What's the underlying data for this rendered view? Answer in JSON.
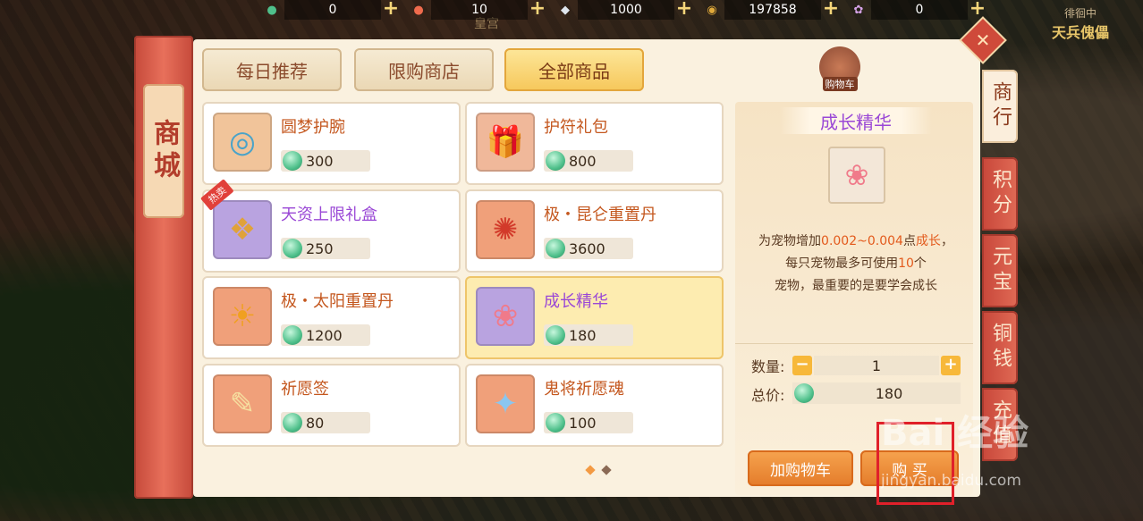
{
  "resources": [
    {
      "icon": "jade-token-icon",
      "glyph": "●",
      "color": "#4fc08b",
      "value": "0"
    },
    {
      "icon": "red-token-icon",
      "glyph": "●",
      "color": "#ef6b4d",
      "value": "10"
    },
    {
      "icon": "silver-ingot-icon",
      "glyph": "◆",
      "color": "#dfe6ee",
      "value": "1000"
    },
    {
      "icon": "copper-coin-icon",
      "glyph": "◉",
      "color": "#e0a93a",
      "value": "197858"
    },
    {
      "icon": "pet-token-icon",
      "glyph": "✿",
      "color": "#d6a3e8",
      "value": "0"
    }
  ],
  "hud": {
    "top_small": "徘徊中",
    "top_big": "天兵傀儡",
    "hint": "皇宫"
  },
  "banner": {
    "title": "商城"
  },
  "tabs": [
    {
      "label": "每日推荐",
      "active": false
    },
    {
      "label": "限购商店",
      "active": false
    },
    {
      "label": "全部商品",
      "active": true
    }
  ],
  "cart": {
    "label": "购物车"
  },
  "items": [
    {
      "name": "圆梦护腕",
      "price": "300",
      "glyph": "◎",
      "bg": "#f1c49a",
      "color": "#4aa3c9",
      "purple": false,
      "hot": false,
      "selected": false
    },
    {
      "name": "护符礼包",
      "price": "800",
      "glyph": "🎁",
      "bg": "#f0b89a",
      "color": "#c04a3a",
      "purple": false,
      "hot": false,
      "selected": false
    },
    {
      "name": "天资上限礼盒",
      "price": "250",
      "glyph": "❖",
      "bg": "#b9a3e0",
      "color": "#e0a23a",
      "purple": true,
      "hot": true,
      "hot_label": "热卖",
      "selected": false
    },
    {
      "name": "极・昆仑重置丹",
      "price": "3600",
      "glyph": "✺",
      "bg": "#f0a07a",
      "color": "#d23a2a",
      "purple": false,
      "hot": false,
      "selected": false
    },
    {
      "name": "极・太阳重置丹",
      "price": "1200",
      "glyph": "☀",
      "bg": "#f0a07a",
      "color": "#f0a020",
      "purple": false,
      "hot": false,
      "selected": false
    },
    {
      "name": "成长精华",
      "price": "180",
      "glyph": "❀",
      "bg": "#b9a3e0",
      "color": "#f07a8a",
      "purple": true,
      "hot": false,
      "selected": true
    },
    {
      "name": "祈愿签",
      "price": "80",
      "glyph": "✎",
      "bg": "#f0a07a",
      "color": "#f6e0a0",
      "purple": false,
      "hot": false,
      "selected": false
    },
    {
      "name": "鬼将祈愿魂",
      "price": "100",
      "glyph": "✦",
      "bg": "#f0a07a",
      "color": "#8ac6f0",
      "purple": false,
      "hot": false,
      "selected": false
    }
  ],
  "detail": {
    "title": "成长精华",
    "desc_1a": "为宠物增加",
    "desc_1b": "0.002~0.004",
    "desc_1c": "点",
    "desc_1d": "成长",
    "desc_1e": "，",
    "desc_2a": "每只宠物最多可使用",
    "desc_2b": "10",
    "desc_2c": "个",
    "desc_3": "宠物，最重要的是要学会成长",
    "qty_label": "数量:",
    "qty_value": "1",
    "total_label": "总价:",
    "total_value": "180",
    "add_cart": "加购物车",
    "buy": "购 买"
  },
  "side_tabs": [
    {
      "label": "商行",
      "active": true
    },
    {
      "label": "积分",
      "active": false
    },
    {
      "label": "元宝",
      "active": false
    },
    {
      "label": "铜钱",
      "active": false
    },
    {
      "label": "充值",
      "active": false
    }
  ],
  "watermark": {
    "logo": "Bai 经验",
    "url": "jingyan.baidu.com"
  }
}
